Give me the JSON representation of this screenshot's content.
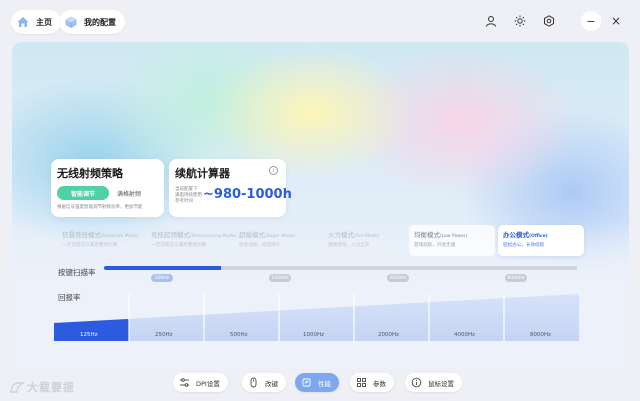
{
  "nav": {
    "home_label": "主页",
    "config_label": "我的配置"
  },
  "window_controls": {
    "minimize": "−",
    "close": "×"
  },
  "wireless_card": {
    "title": "无线射频策略",
    "smart_label": "智能调节",
    "full_label": "满格射频",
    "description": "根据信号强度智能调节射频功率，更加节能"
  },
  "battery_card": {
    "title": "续航计算器",
    "info_icon": "i",
    "note_line1": "当前配置下",
    "note_line2": "满电持续使用",
    "note_line3": "参考时间",
    "value": "~980-1000h"
  },
  "modes": [
    {
      "name": "狂暴竞技模式",
      "sub": "(Hardcore Mode)",
      "desc": "一次充电可以满足整场比赛"
    },
    {
      "name": "竞技超频模式",
      "sub": "(Overclocking Mode)",
      "desc": "一次充电可以满足整场比赛"
    },
    {
      "name": "超能模式",
      "sub": "(Super Mode)",
      "desc": "性能强劲，续航持久"
    },
    {
      "name": "火力模式",
      "sub": "(Fire Mode)",
      "desc": "激情游戏，火力全开"
    },
    {
      "name": "均衡模式",
      "sub": "(Low Power)",
      "desc": "游戏续航，开会无虞"
    },
    {
      "name": "办公模式",
      "sub": "(Office)",
      "desc": "轻松办公，长效续航"
    }
  ],
  "scan_rate": {
    "label": "按键扫描率",
    "ticks": [
      "500Hz",
      "1000Hz",
      "4000Hz",
      "8000Hz"
    ],
    "selected_index": 0
  },
  "polling": {
    "label": "回报率",
    "options": [
      "125Hz",
      "250Hz",
      "500Hz",
      "1000Hz",
      "2000Hz",
      "4000Hz",
      "8000Hz"
    ],
    "selected_index": 0
  },
  "bottom_nav": [
    {
      "label": "DPI设置"
    },
    {
      "label": "改键"
    },
    {
      "label": "性能"
    },
    {
      "label": "参数"
    },
    {
      "label": "鼠标设置"
    }
  ],
  "watermark": "大载要提",
  "colors": {
    "accent": "#2d5be0",
    "smart_green": "#4fd1a1",
    "active_tab": "#7fa7ef"
  }
}
